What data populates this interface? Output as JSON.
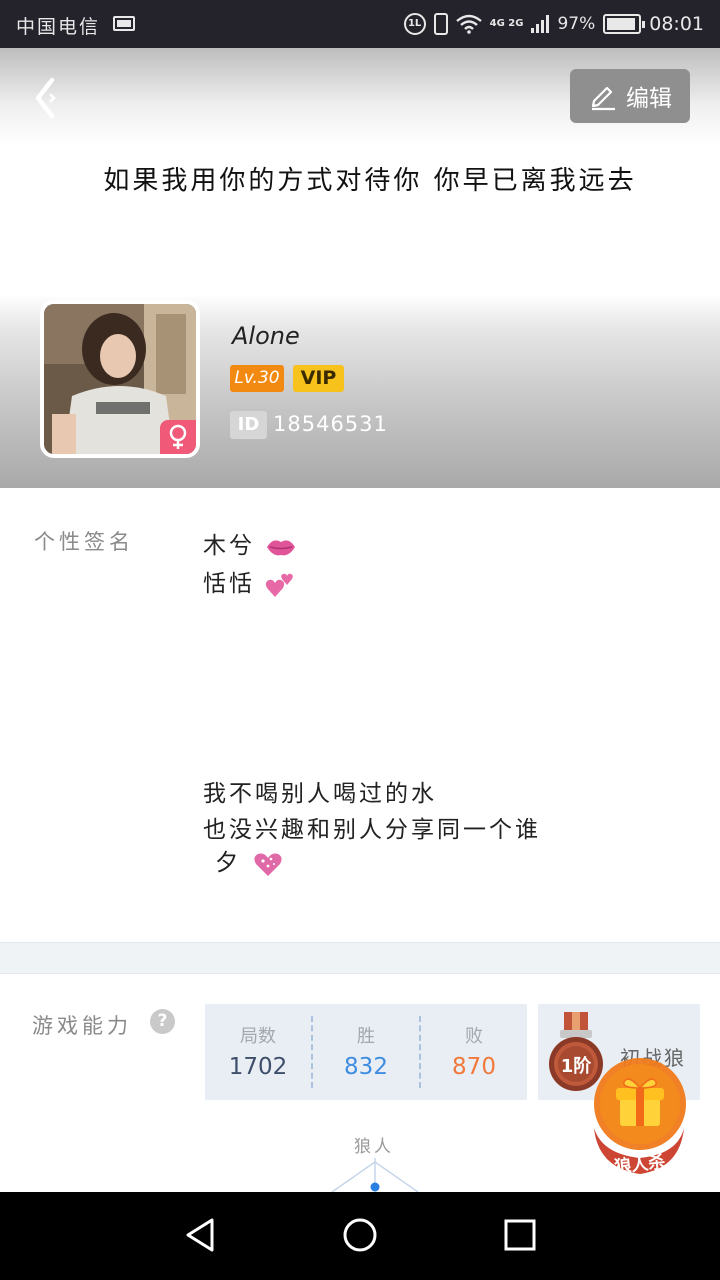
{
  "status_bar": {
    "carrier": "中国电信",
    "hd_label": "1L",
    "network": "4G 2G",
    "battery": "97%",
    "time": "08:01"
  },
  "header": {
    "edit_label": "编辑",
    "motto": "如果我用你的方式对待你 你早已离我远去"
  },
  "profile": {
    "nickname": "Alone",
    "level": "Lv.30",
    "vip": "VIP",
    "id_tag": "ID",
    "id_value": "18546531",
    "gender": "♀"
  },
  "signature": {
    "label": "个性签名",
    "lines": [
      "木兮",
      "恬恬",
      "我不喝别人喝过的水",
      "也没兴趣和别人分享同一个谁",
      "夕"
    ]
  },
  "ability": {
    "label": "游戏能力",
    "help": "?",
    "stats": [
      {
        "label": "局数",
        "value": "1702",
        "color": "#3d4f6a"
      },
      {
        "label": "胜",
        "value": "832",
        "color": "#3f8de0"
      },
      {
        "label": "败",
        "value": "870",
        "color": "#f0793b"
      }
    ],
    "rank_medal": "1阶",
    "rank_name": "初战狼",
    "role_label": "狼人",
    "gift_caption": "狼人杀"
  },
  "colors": {
    "accent_orange": "#f28a12",
    "vip_yellow": "#f7c21c",
    "gender_pink": "#f05a78",
    "win_blue": "#3f8de0",
    "lose_orange": "#f0793b"
  }
}
